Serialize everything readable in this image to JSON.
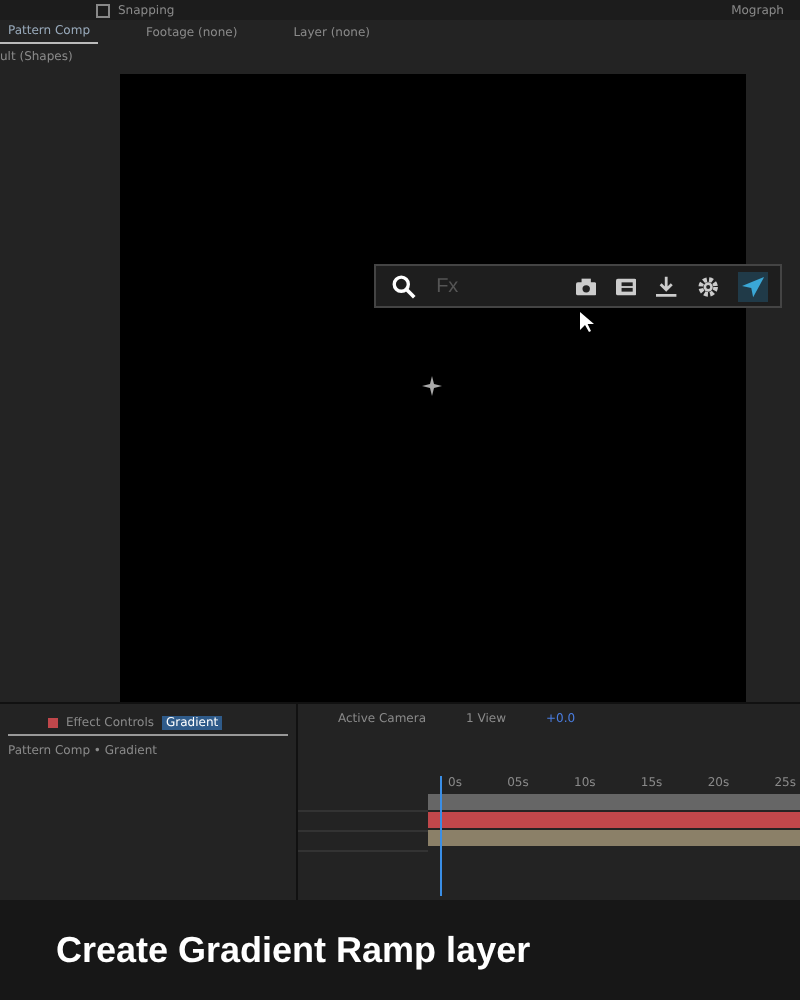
{
  "top_bar": {
    "snapping": {
      "label": "Snapping",
      "checked": false
    },
    "workspace": "Mograph"
  },
  "viewer_tabs": [
    {
      "label": "Pattern Comp",
      "selected": true
    },
    {
      "label": "Footage (none)",
      "selected": false
    },
    {
      "label": "Layer (none)",
      "selected": false
    }
  ],
  "project_label": "ult (Shapes)",
  "search_bar": {
    "placeholder": "Fx"
  },
  "effect_controls": {
    "tab": "Effect Controls",
    "layer": "Gradient",
    "breadcrumb": "Pattern Comp • Gradient"
  },
  "viewer_toolbar": {
    "camera": "Active Camera",
    "views": "1 View",
    "exposure": "+0.0"
  },
  "timeline": {
    "ticks": [
      "0s",
      "05s",
      "10s",
      "15s",
      "20s",
      "25s"
    ],
    "layers": [
      {
        "color": "#c0474b"
      },
      {
        "color": "#8b8068"
      }
    ]
  },
  "caption": "Create Gradient Ramp layer"
}
